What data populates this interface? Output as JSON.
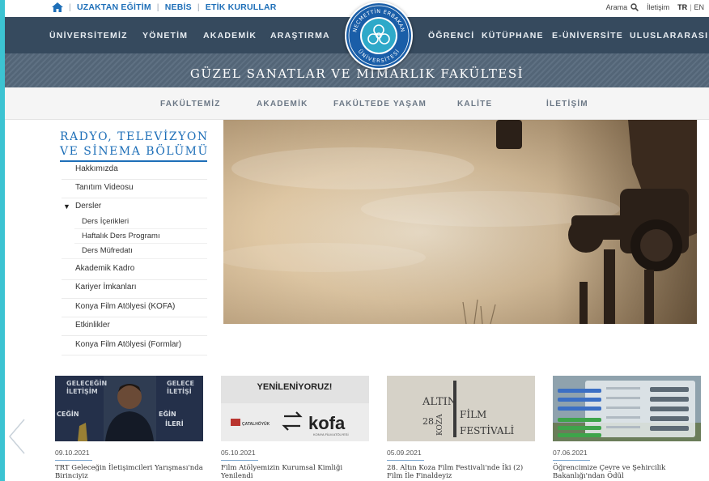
{
  "topbar": {
    "links": [
      "UZAKTAN EĞİTİM",
      "NEBİS",
      "ETİK KURULLAR"
    ],
    "search_label": "Arama",
    "contact_label": "İletişim",
    "lang_tr": "TR",
    "lang_sep": "|",
    "lang_en": "EN"
  },
  "mainnav": {
    "left": [
      "ÜNİVERSİTEMİZ",
      "YÖNETİM",
      "AKADEMİK",
      "ARAŞTIRMA"
    ],
    "right": [
      "ÖĞRENCİ",
      "KÜTÜPHANE",
      "E-ÜNİVERSİTE",
      "ULUSLARARASI"
    ]
  },
  "logo": {
    "top_text": "NECMETTİN ERBAKAN",
    "bottom_text": "ÜNİVERSİTESİ"
  },
  "faculty_title": "GÜZEL SANATLAR VE MİMARLIK FAKÜLTESİ",
  "subnav": [
    "FAKÜLTEMİZ",
    "AKADEMİK",
    "FAKÜLTEDE YAŞAM",
    "KALİTE",
    "İLETİŞİM"
  ],
  "sidebar": {
    "title_line1": "RADYO, TELEVİZYON",
    "title_line2": "VE SİNEMA BÖLÜMÜ",
    "items": [
      {
        "label": "Hakkımızda"
      },
      {
        "label": "Tanıtım Videosu"
      },
      {
        "label": "Dersler"
      },
      {
        "label": "Akademik Kadro"
      },
      {
        "label": "Kariyer İmkanları"
      },
      {
        "label": "Konya Film Atölyesi (KOFA)"
      },
      {
        "label": "Etkinlikler"
      },
      {
        "label": "Konya Film Atölyesi (Formlar)"
      }
    ],
    "subitems": [
      "Ders İçerikleri",
      "Haftalık Ders Programı",
      "Ders Müfredatı"
    ],
    "expand_glyph": "▼"
  },
  "news": [
    {
      "date": "09.10.2021",
      "title": "TRT Geleceğin İletişimcileri Yarışması'nda Birinciyiz",
      "thumb_text": [
        "GELECEĞİN",
        "İLETİŞİM",
        "GELECE",
        "İLETİŞİ",
        "CEĞİN",
        "EĞİN",
        "İLERİ"
      ]
    },
    {
      "date": "05.10.2021",
      "title": "Film Atölyemizin Kurumsal Kimliği Yenilendi",
      "thumb_text": [
        "YENİLENİYORUZ!",
        "ÇATALHÖYÜK",
        "kofa",
        "KONYA FİLM ATÖLYESİ"
      ]
    },
    {
      "date": "05.09.2021",
      "title": "28. Altın Koza Film Festivali'nde İki (2) Film İle Finaldeyiz",
      "thumb_text": [
        "ALTIN",
        "KOZA",
        "FİLM",
        "FESTİVALİ",
        "28."
      ]
    },
    {
      "date": "07.06.2021",
      "title": "Öğrencimize Çevre ve Şehircilik Bakanlığı'ndan Ödül",
      "thumb_text": []
    }
  ],
  "colors": {
    "accent_blue": "#1e6fb8",
    "nav_bg": "#364a5e",
    "band_bg": "#56697c",
    "frame_cyan": "#3cc3d2"
  }
}
